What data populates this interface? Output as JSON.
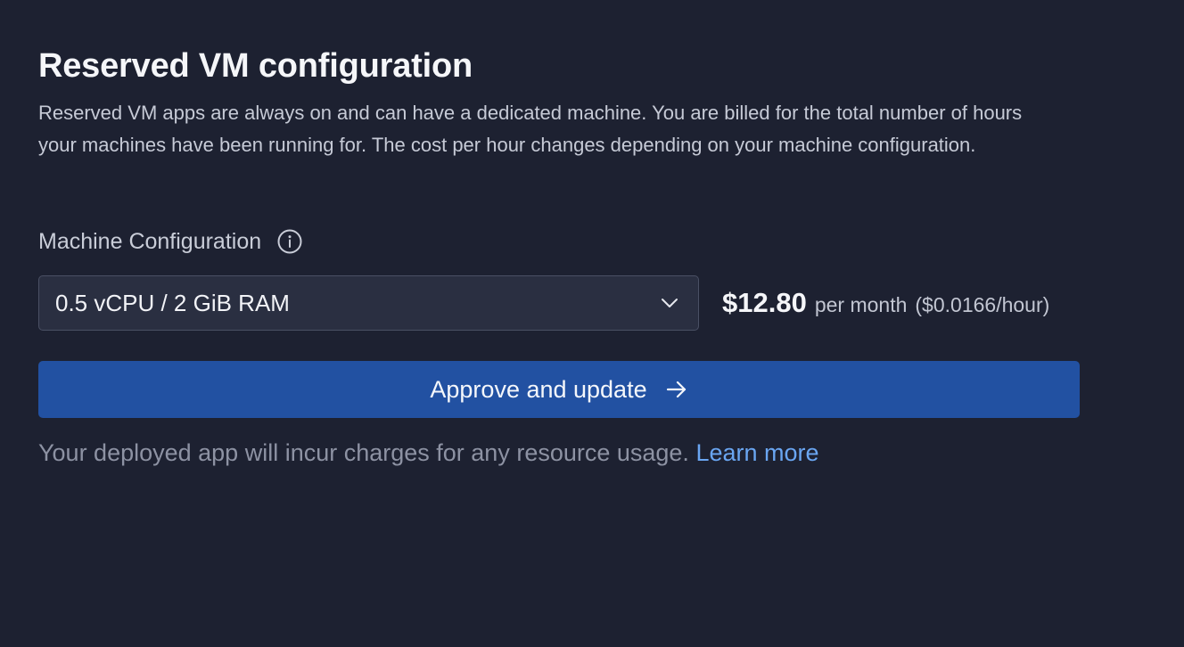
{
  "section": {
    "title": "Reserved VM configuration",
    "description": "Reserved VM apps are always on and can have a dedicated machine. You are billed for the total number of hours your machines have been running for. The cost per hour changes depending on your machine configuration."
  },
  "machine_config": {
    "label": "Machine Configuration",
    "info_icon": "info-circle-icon",
    "selected_value": "0.5 vCPU / 2 GiB RAM",
    "dropdown_icon": "chevron-down-icon"
  },
  "pricing": {
    "amount": "$12.80",
    "period": "per month",
    "hourly": "($0.0166/hour)"
  },
  "approve_button": {
    "label": "Approve and update",
    "icon": "arrow-right-icon"
  },
  "footnote": {
    "text": "Your deployed app will incur charges for any resource usage.",
    "link_label": "Learn more"
  },
  "colors": {
    "background": "#1d2131",
    "primary_button": "#2251a2",
    "link": "#6aa6f2",
    "select_background": "#2a2f41"
  }
}
